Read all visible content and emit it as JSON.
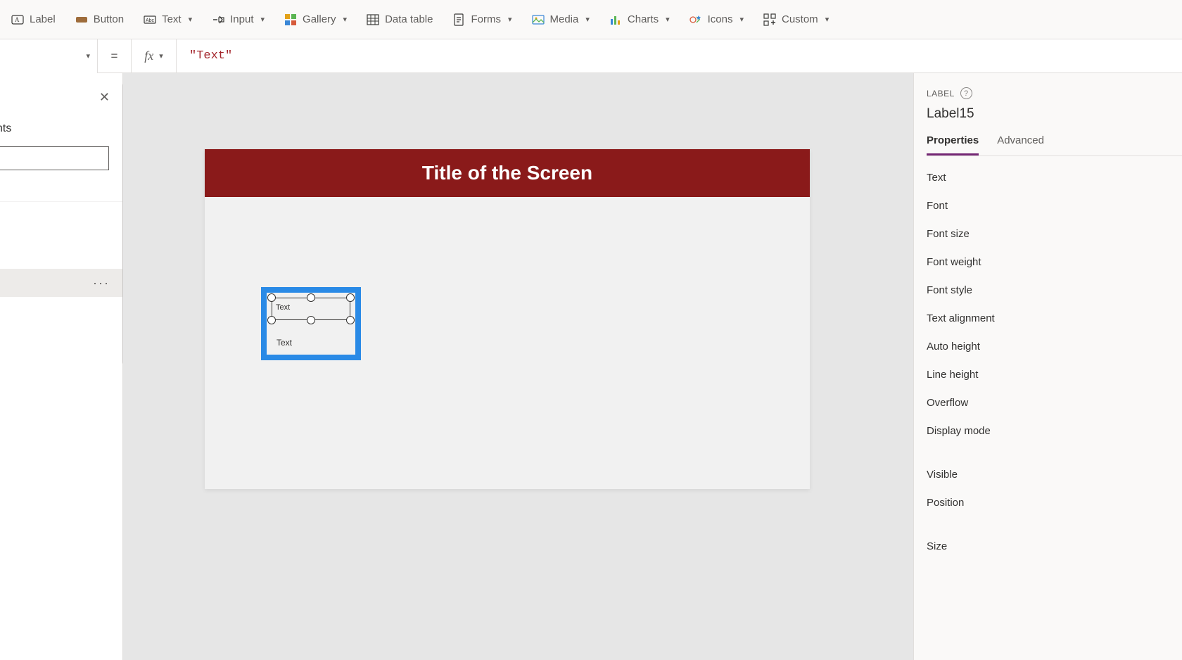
{
  "toolbar": {
    "items": [
      {
        "label": "Label",
        "icon": "text-label-icon",
        "hasChevron": false
      },
      {
        "label": "Button",
        "icon": "button-icon",
        "hasChevron": false
      },
      {
        "label": "Text",
        "icon": "text-field-icon",
        "hasChevron": true
      },
      {
        "label": "Input",
        "icon": "input-icon",
        "hasChevron": true
      },
      {
        "label": "Gallery",
        "icon": "gallery-icon",
        "hasChevron": true
      },
      {
        "label": "Data table",
        "icon": "data-table-icon",
        "hasChevron": false
      },
      {
        "label": "Forms",
        "icon": "forms-icon",
        "hasChevron": true
      },
      {
        "label": "Media",
        "icon": "media-icon",
        "hasChevron": true
      },
      {
        "label": "Charts",
        "icon": "charts-icon",
        "hasChevron": true
      },
      {
        "label": "Icons",
        "icon": "icons-icon",
        "hasChevron": true
      },
      {
        "label": "Custom",
        "icon": "custom-icon",
        "hasChevron": true
      }
    ]
  },
  "formula_bar": {
    "equals": "=",
    "fx": "fx",
    "expression": "\"Text\""
  },
  "left_panel": {
    "header_fragment": "nts",
    "selected_more": "···"
  },
  "canvas": {
    "title": "Title of the Screen",
    "selected_label_text": "Text",
    "second_label_text": "Text"
  },
  "right_panel": {
    "category": "LABEL",
    "element_name": "Label15",
    "tabs": {
      "properties": "Properties",
      "advanced": "Advanced"
    },
    "props_group1": [
      "Text",
      "Font",
      "Font size",
      "Font weight",
      "Font style",
      "Text alignment",
      "Auto height",
      "Line height",
      "Overflow",
      "Display mode"
    ],
    "props_group2": [
      "Visible",
      "Position",
      "Size"
    ]
  }
}
